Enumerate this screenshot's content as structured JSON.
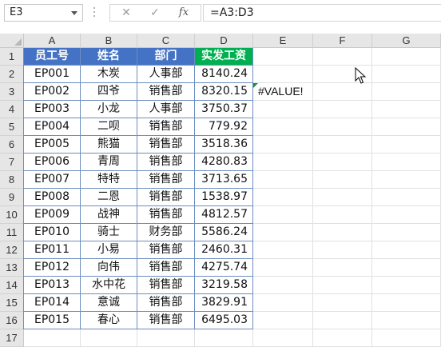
{
  "name_box": "E3",
  "formula_buttons": {
    "cancel": "✕",
    "enter": "✓",
    "fx": "fx"
  },
  "formula": "=A3:D3",
  "columns": [
    "A",
    "B",
    "C",
    "D",
    "E",
    "F",
    "G"
  ],
  "rows": [
    "1",
    "2",
    "3",
    "4",
    "5",
    "6",
    "7",
    "8",
    "9",
    "10",
    "11",
    "12",
    "13",
    "14",
    "15",
    "16",
    "17"
  ],
  "headers": [
    "员工号",
    "姓名",
    "部门",
    "实发工资"
  ],
  "data": [
    [
      "EP001",
      "木炭",
      "人事部",
      "8140.24"
    ],
    [
      "EP002",
      "四爷",
      "销售部",
      "8320.15"
    ],
    [
      "EP003",
      "小龙",
      "人事部",
      "3750.37"
    ],
    [
      "EP004",
      "二呗",
      "销售部",
      "779.92"
    ],
    [
      "EP005",
      "熊猫",
      "销售部",
      "3518.36"
    ],
    [
      "EP006",
      "青周",
      "销售部",
      "4280.83"
    ],
    [
      "EP007",
      "特特",
      "销售部",
      "3713.65"
    ],
    [
      "EP008",
      "二恩",
      "销售部",
      "1538.97"
    ],
    [
      "EP009",
      "战神",
      "销售部",
      "4812.57"
    ],
    [
      "EP010",
      "骑士",
      "财务部",
      "5586.24"
    ],
    [
      "EP011",
      "小易",
      "销售部",
      "2460.31"
    ],
    [
      "EP012",
      "向伟",
      "销售部",
      "4275.74"
    ],
    [
      "EP013",
      "水中花",
      "销售部",
      "3219.58"
    ],
    [
      "EP014",
      "意诚",
      "销售部",
      "3829.91"
    ],
    [
      "EP015",
      "春心",
      "销售部",
      "6495.03"
    ]
  ],
  "e3_value": "#VALUE!",
  "colors": {
    "header_blue": "#4472c4",
    "header_green": "#00b050",
    "error_indicator": "#1a8f3a"
  }
}
